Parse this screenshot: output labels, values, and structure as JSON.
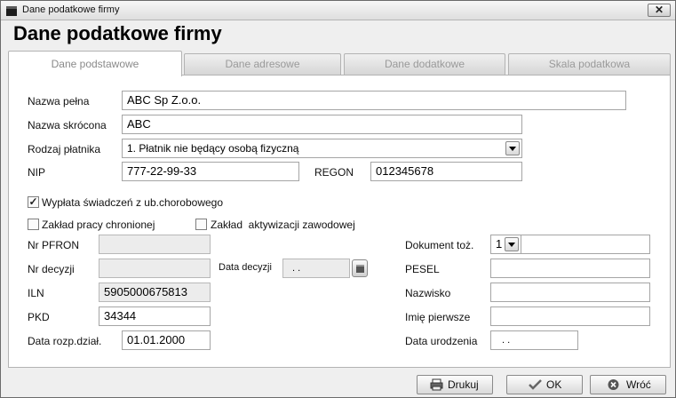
{
  "window": {
    "title": "Dane podatkowe firmy"
  },
  "heading": "Dane podatkowe firmy",
  "tabs": [
    {
      "label": "Dane podstawowe",
      "active": true
    },
    {
      "label": "Dane adresowe",
      "active": false
    },
    {
      "label": "Dane dodatkowe",
      "active": false
    },
    {
      "label": "Skala podatkowa",
      "active": false
    }
  ],
  "form": {
    "nazwa_pelna": {
      "label": "Nazwa pełna",
      "value": "ABC Sp Z.o.o."
    },
    "nazwa_skrocona": {
      "label": "Nazwa skrócona",
      "value": "ABC"
    },
    "rodzaj_platnika": {
      "label": "Rodzaj płatnika",
      "value": "1. Płatnik nie będący osobą fizyczną"
    },
    "nip": {
      "label": "NIP",
      "value": "777-22-99-33"
    },
    "regon": {
      "label": "REGON",
      "value": "012345678"
    },
    "wyplata": {
      "label": "Wypłata świadczeń z ub.chorobowego",
      "checked": true,
      "mark": "✓"
    },
    "zaklad_chroniony": {
      "label": "Zakład pracy chronionej",
      "checked": false
    },
    "zaklad_aktywizacji": {
      "label": "Zakład  aktywizacji zawodowej",
      "checked": false
    },
    "nr_pfron": {
      "label": "Nr PFRON",
      "value": ""
    },
    "nr_decyzji": {
      "label": "Nr decyzji",
      "value": ""
    },
    "data_decyzji": {
      "label": "Data decyzji",
      "value": ". ."
    },
    "iln": {
      "label": "ILN",
      "value": "5905000675813"
    },
    "pkd": {
      "label": "PKD",
      "value": "34344"
    },
    "data_rozp": {
      "label": "Data rozp.dział.",
      "value": "01.01.2000"
    },
    "dokument": {
      "label": "Dokument toż.",
      "value": "1"
    },
    "pesel": {
      "label": "PESEL",
      "value": ""
    },
    "nazwisko": {
      "label": "Nazwisko",
      "value": ""
    },
    "imie": {
      "label": "Imię pierwsze",
      "value": ""
    },
    "data_urodzenia": {
      "label": "Data urodzenia",
      "value": ". ."
    }
  },
  "footer": {
    "drukuj": "Drukuj",
    "ok": "OK",
    "wroc": "Wróć"
  },
  "icons": {
    "drukuj": "printer-icon",
    "ok": "checkmark-icon",
    "wroc": "close-circle-icon"
  }
}
